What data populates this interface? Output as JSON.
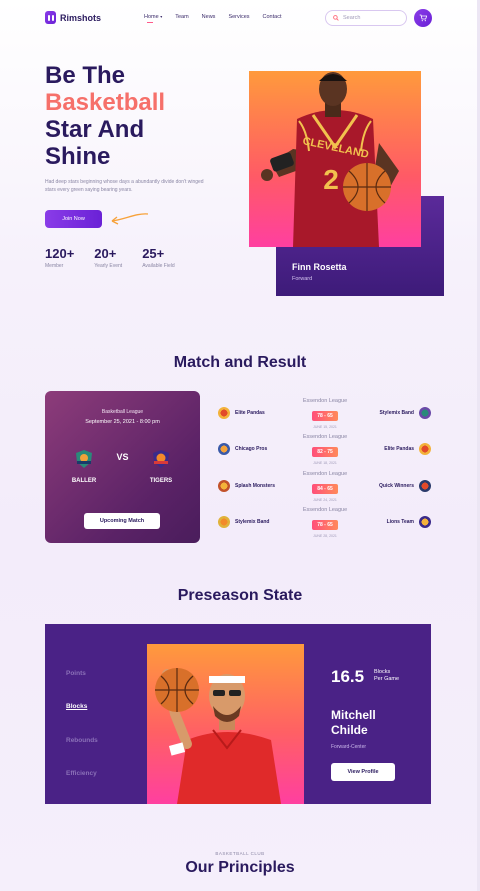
{
  "nav": {
    "brand": "Rimshots",
    "links": [
      "Home",
      "Team",
      "News",
      "Services",
      "Contact"
    ],
    "search_placeholder": "Search"
  },
  "hero": {
    "title_line1": "Be The",
    "title_line2": "Basketball",
    "title_line3": "Star And",
    "title_line4": "Shine",
    "description": "Had deep stars beginning whose days a abundantly divide don't winged stars every green saying bearing years.",
    "cta": "Join Now",
    "stats": [
      {
        "value": "120+",
        "label": "Member"
      },
      {
        "value": "20+",
        "label": "Yearly Event"
      },
      {
        "value": "25+",
        "label": "Available Field"
      }
    ],
    "player_name": "Finn Rosetta",
    "player_position": "Forward",
    "player_jersey": "CLEVELAND",
    "player_number": "2"
  },
  "match": {
    "title": "Match and Result",
    "card": {
      "league": "Basketball League",
      "date": "September 25, 2021 - 8:00 pm",
      "home": "BALLER",
      "away": "TIGERS",
      "vs": "VS",
      "button": "Upcoming Match"
    },
    "results": [
      {
        "league": "Essendon League",
        "home": "Elite Pandas",
        "score": "78 - 65",
        "date": "JUNE 15, 2021",
        "away": "Stylemix Band"
      },
      {
        "league": "Essendon League",
        "home": "Chicago Pros",
        "score": "82 - 75",
        "date": "JUNE 18, 2021",
        "away": "Elite Pandas"
      },
      {
        "league": "Essendon League",
        "home": "Splash Monsters",
        "score": "84 - 65",
        "date": "JUNE 24, 2021",
        "away": "Quick Winners"
      },
      {
        "league": "Essendon League",
        "home": "Stylemix Band",
        "score": "78 - 65",
        "date": "JUNE 28, 2021",
        "away": "Lions Team"
      }
    ]
  },
  "preseason": {
    "title": "Preseason State",
    "menu": [
      "Points",
      "Blocks",
      "Rebounds",
      "Efficiency"
    ],
    "active_menu": "Blocks",
    "stat_value": "16.5",
    "stat_label_line1": "Blocks",
    "stat_label_line2": "Per Game",
    "name_line1": "Mitchell",
    "name_line2": "Childe",
    "position": "Forward-Center",
    "button": "View Profile"
  },
  "principles": {
    "eyebrow": "BASKETBALL CLUB",
    "title": "Our Principles"
  },
  "colors": {
    "primary": "#6a21d6",
    "accent": "#f6706a",
    "navy": "#2a1a5e",
    "panel": "#4a2286"
  }
}
